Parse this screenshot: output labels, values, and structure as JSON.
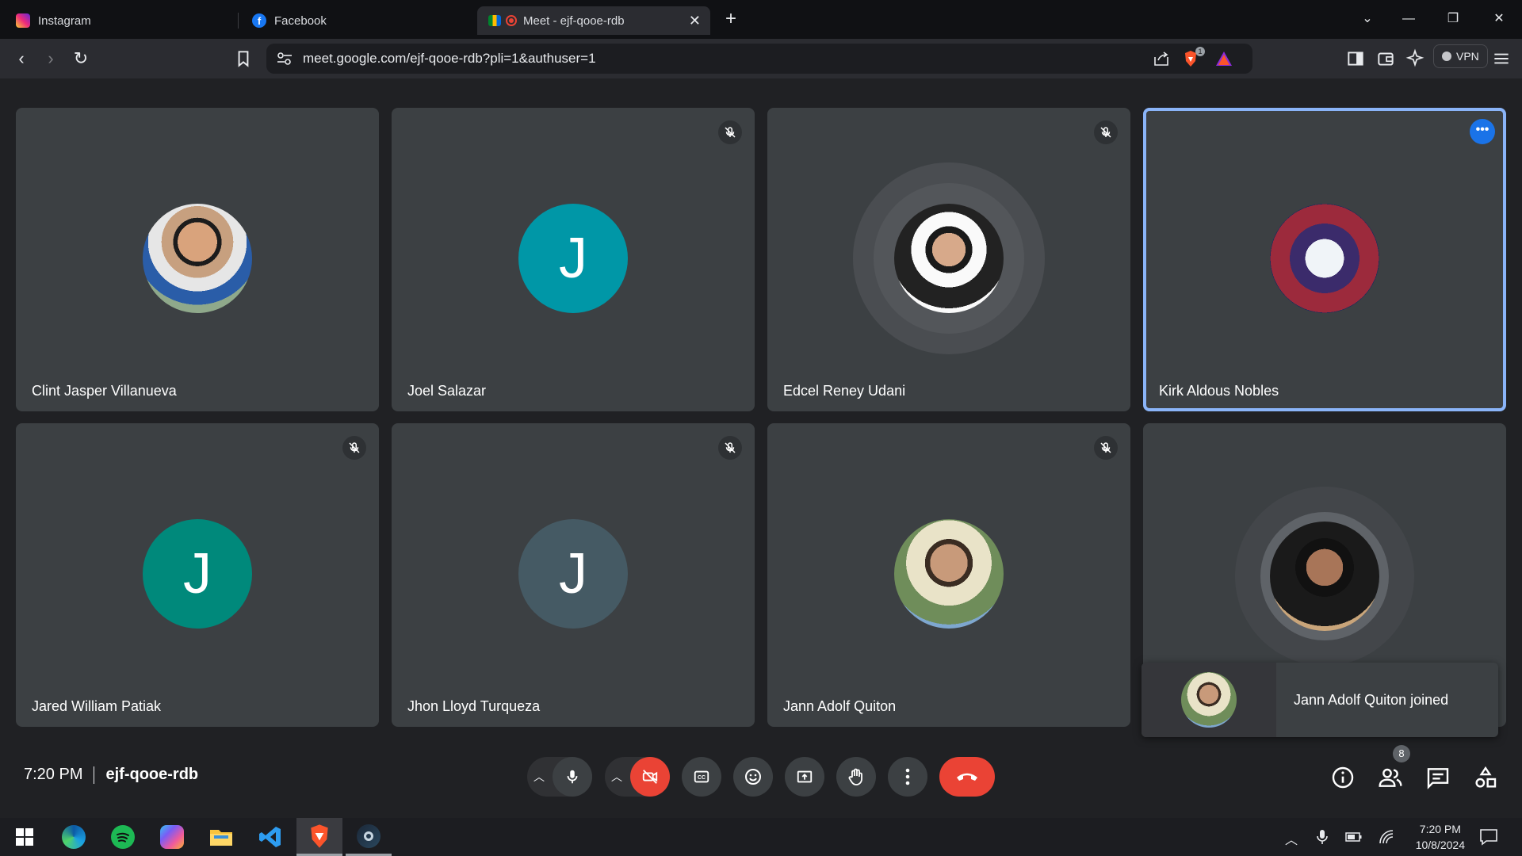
{
  "browser": {
    "tabs": [
      {
        "title": "Instagram",
        "icon": "instagram-icon"
      },
      {
        "title": "Facebook",
        "icon": "facebook-icon"
      },
      {
        "title": "Meet - ejf-qooe-rdb",
        "icon": "google-meet-icon",
        "active": true
      }
    ],
    "url": "meet.google.com/ejf-qooe-rdb?pli=1&authuser=1",
    "vpn_label": "VPN",
    "shield_badge": "1"
  },
  "meet": {
    "participants": [
      {
        "name": "Clint Jasper Villanueva",
        "muted": false,
        "avatar": "photo"
      },
      {
        "name": "Joel Salazar",
        "muted": true,
        "avatar": "J",
        "color": "#0097a7"
      },
      {
        "name": "Edcel Reney Udani",
        "muted": true,
        "avatar": "photo"
      },
      {
        "name": "Kirk Aldous Nobles",
        "muted": false,
        "avatar": "ghost",
        "speaking": true
      },
      {
        "name": "Jared William Patiak",
        "muted": true,
        "avatar": "J",
        "color": "#00897b"
      },
      {
        "name": "Jhon Lloyd Turqueza",
        "muted": true,
        "avatar": "J",
        "color": "#455a64"
      },
      {
        "name": "Jann Adolf Quiton",
        "muted": true,
        "avatar": "photo"
      },
      {
        "name": "",
        "muted": false,
        "avatar": "photo"
      }
    ],
    "toast": "Jann Adolf Quiton joined",
    "time": "7:20 PM",
    "meeting_code": "ejf-qooe-rdb",
    "people_count": "8"
  },
  "taskbar": {
    "time": "7:20 PM",
    "date": "10/8/2024"
  }
}
